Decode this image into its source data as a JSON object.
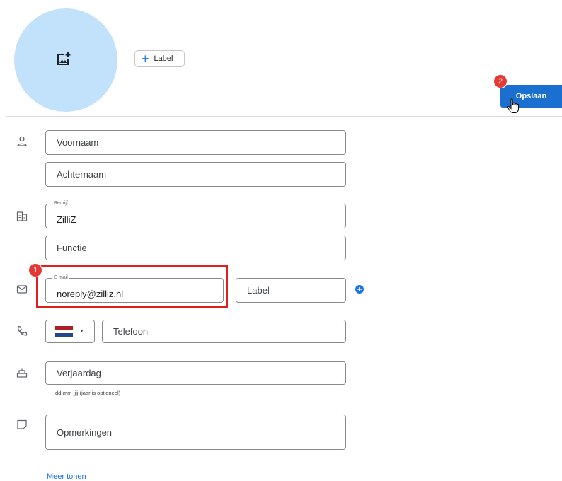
{
  "header": {
    "avatar_icon": "add-photo-icon",
    "label_button": "Label",
    "save_button": "Opslaan",
    "save_badge": "2"
  },
  "fields": {
    "first_name": {
      "placeholder": "Voornaam"
    },
    "last_name": {
      "placeholder": "Achternaam"
    },
    "company": {
      "label": "Bedrijf",
      "value": "ZilliZ"
    },
    "job_title": {
      "placeholder": "Functie"
    },
    "email": {
      "label": "E-mail",
      "value": "noreply@zilliz.nl",
      "badge": "1"
    },
    "email_label": {
      "placeholder": "Label"
    },
    "phone": {
      "placeholder": "Telefoon",
      "country": "NL"
    },
    "birthday": {
      "placeholder": "Verjaardag",
      "helper": "dd-mm-jjjj (jaar is optioneel)"
    },
    "notes": {
      "placeholder": "Opmerkingen"
    }
  },
  "footer": {
    "more_link": "Meer tonen"
  },
  "colors": {
    "accent": "#1a73e8",
    "save_button": "#1a6fd0",
    "avatar_bg": "#c2e2fb",
    "annotation": "#e02020",
    "flag_red": "#ae1c28",
    "flag_blue": "#21468b"
  }
}
